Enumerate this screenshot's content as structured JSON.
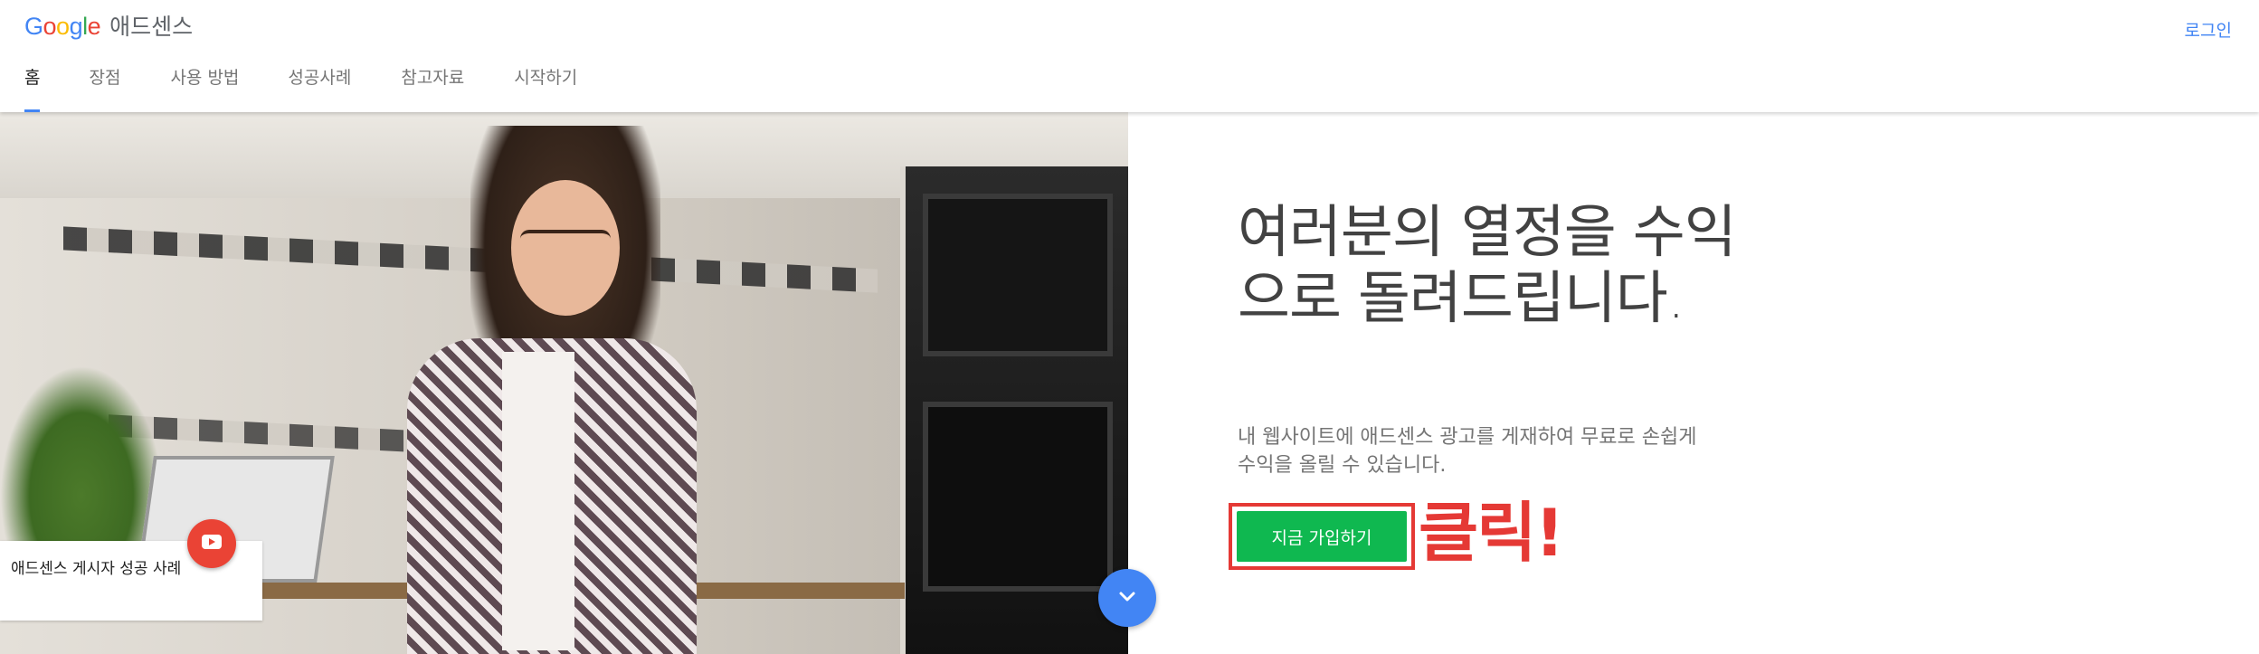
{
  "header": {
    "logo": {
      "wordmark": "Google",
      "product": "애드센스"
    },
    "login_label": "로그인",
    "nav": [
      {
        "label": "홈",
        "active": true
      },
      {
        "label": "장점",
        "active": false
      },
      {
        "label": "사용 방법",
        "active": false
      },
      {
        "label": "성공사례",
        "active": false
      },
      {
        "label": "참고자료",
        "active": false
      },
      {
        "label": "시작하기",
        "active": false
      }
    ]
  },
  "hero": {
    "story_card_text": "애드센스 게시자 성공 사례",
    "play_icon": "youtube-play-icon",
    "scroll_icon": "chevron-down-icon"
  },
  "main": {
    "headline": "여러분의 열정을 수익으로 돌려드립니다.",
    "subtext": "내 웹사이트에 애드센스 광고를 게재하여 무료로 손쉽게 수익을 올릴 수 있습니다.",
    "signup_label": "지금 가입하기",
    "annotation": "클릭!"
  },
  "colors": {
    "accent_blue": "#4285f4",
    "signup_green": "#0fb850",
    "annotation_red": "#e53935",
    "youtube_red": "#ea4335"
  }
}
